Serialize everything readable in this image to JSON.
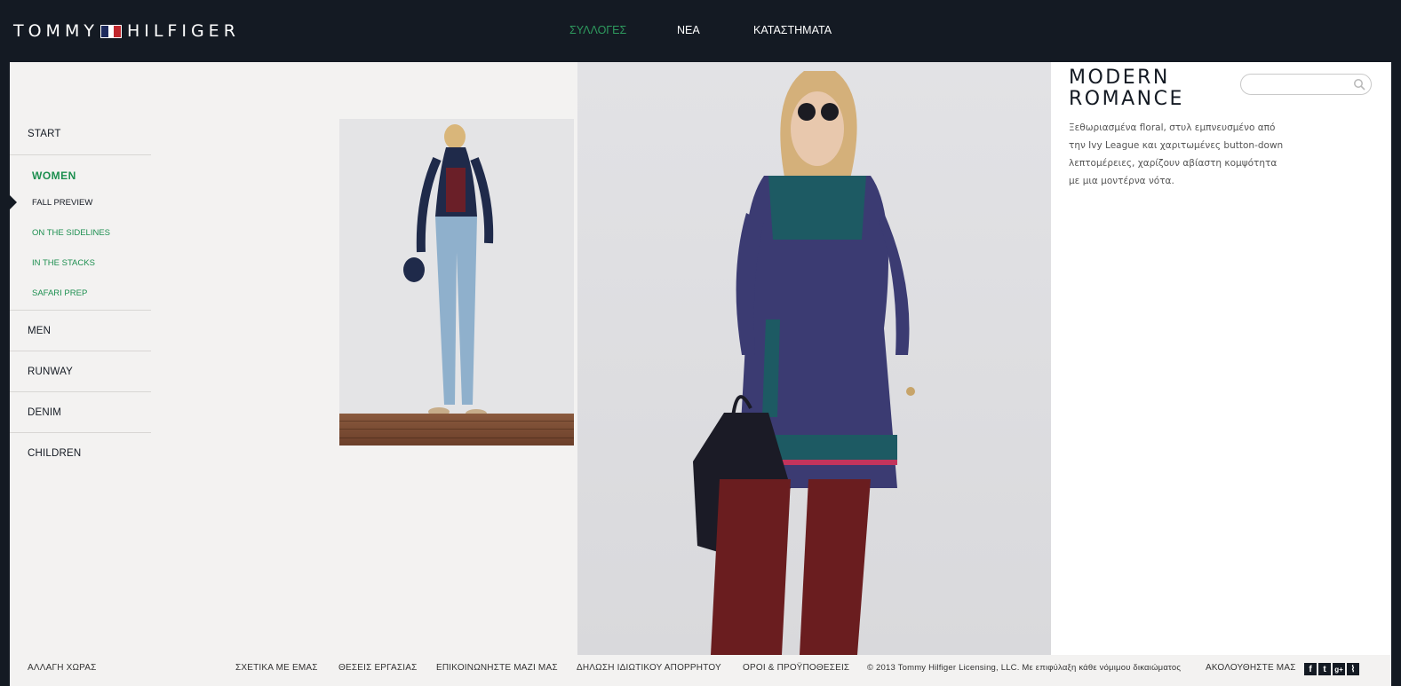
{
  "brand": {
    "logo_left": "TOMMY",
    "logo_right": "HILFIGER",
    "flag_colors": {
      "left": "#1d2a5c",
      "mid": "#ffffff",
      "right": "#c1272d"
    }
  },
  "topnav": {
    "items": [
      "ΣΥΛΛΟΓΕΣ",
      "ΝΕΑ",
      "ΚΑΤΑΣΤΗΜΑΤΑ"
    ],
    "active_color": "#2e9a5e"
  },
  "sidebar": {
    "start": "START",
    "women": "WOMEN",
    "women_sub": [
      "FALL PREVIEW",
      "ON THE SIDELINES",
      "IN THE STACKS",
      "SAFARI PREP"
    ],
    "men": "MEN",
    "runway": "RUNWAY",
    "denim": "DENIM",
    "children": "CHILDREN",
    "accent_color": "#1d8f50"
  },
  "panel": {
    "title_line1": "MODERN",
    "title_line2": "ROMANCE",
    "description": "Ξεθωριασμένα floral, στυλ εμπνευσμένο από την Ivy League και χαριτωμένες button-down λεπτομέρειες, χαρίζουν αβίαστη κομψότητα με μια μοντέρνα νότα.",
    "search": {
      "value": "",
      "icon": "search-icon"
    }
  },
  "footer": {
    "change_country": "ΑΛΛΑΓΗ ΧΩΡΑΣ",
    "about": "ΣΧΕΤΙΚΑ ΜΕ ΕΜΑΣ",
    "jobs": "ΘΕΣΕΙΣ ΕΡΓΑΣΙΑΣ",
    "contact": "ΕΠΙΚΟΙΝΩΝΗΣΤΕ ΜΑΖΙ ΜΑΣ",
    "privacy": "ΔΗΛΩΣΗ ΙΔΙΩΤΙΚΟΥ ΑΠΟΡΡΗΤΟΥ",
    "terms": "ΟΡΟΙ & ΠΡΟΫΠΟΘΕΣΕΙΣ",
    "copyright": "© 2013 Tommy Hilfiger Licensing, LLC. Με επιφύλαξη κάθε νόμιμου δικαιώματος",
    "follow": "ΑΚΟΛΟΥΘΗΣΤΕ ΜΑΣ",
    "social": [
      {
        "name": "facebook-icon",
        "glyph": "f"
      },
      {
        "name": "twitter-icon",
        "glyph": "t"
      },
      {
        "name": "googleplus-icon",
        "glyph": "g+"
      },
      {
        "name": "rss-icon",
        "glyph": "⌇"
      }
    ]
  }
}
